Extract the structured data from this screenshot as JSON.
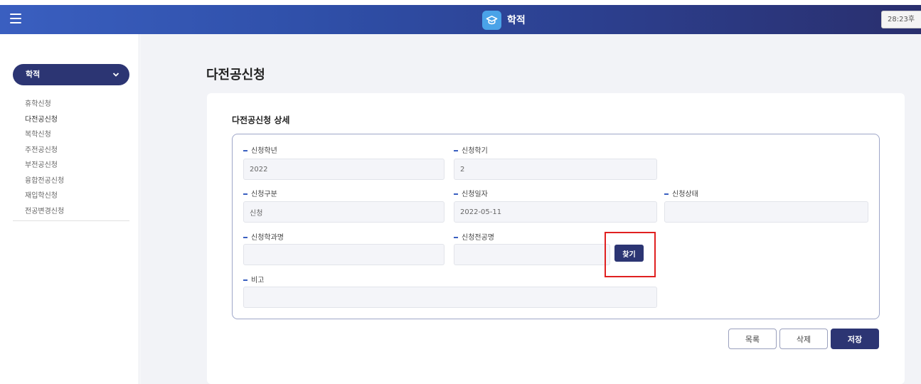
{
  "header": {
    "title": "학적",
    "clock": "28:23후",
    "menu_icon": "hamburger-icon",
    "logo_icon": "graduation-cap-icon"
  },
  "sidebar": {
    "toggle_label": "학적",
    "items": [
      {
        "label": "휴학신청"
      },
      {
        "label": "다전공신청"
      },
      {
        "label": "복학신청"
      },
      {
        "label": "주전공신청"
      },
      {
        "label": "부전공신청"
      },
      {
        "label": "융합전공신청"
      },
      {
        "label": "재입학신청"
      },
      {
        "label": "전공변경신청"
      }
    ]
  },
  "page": {
    "title": "다전공신청",
    "section_title": "다전공신청 상세"
  },
  "form": {
    "year_label": "신청학년",
    "year_value": "2022",
    "semester_label": "신청학기",
    "semester_value": "2",
    "type_label": "신청구분",
    "type_value": "신청",
    "date_label": "신청일자",
    "date_value": "2022-05-11",
    "status_label": "신청상태",
    "status_value": "",
    "dept_label": "신청학과명",
    "dept_value": "",
    "major_label": "신청전공명",
    "major_value": "",
    "find_label": "찾기",
    "note_label": "비고",
    "note_value": ""
  },
  "actions": {
    "list_label": "목록",
    "delete_label": "삭제",
    "save_label": "저장"
  },
  "colors": {
    "primary": "#2c3573",
    "accent": "#3a5fc0",
    "highlight": "#e02020"
  }
}
